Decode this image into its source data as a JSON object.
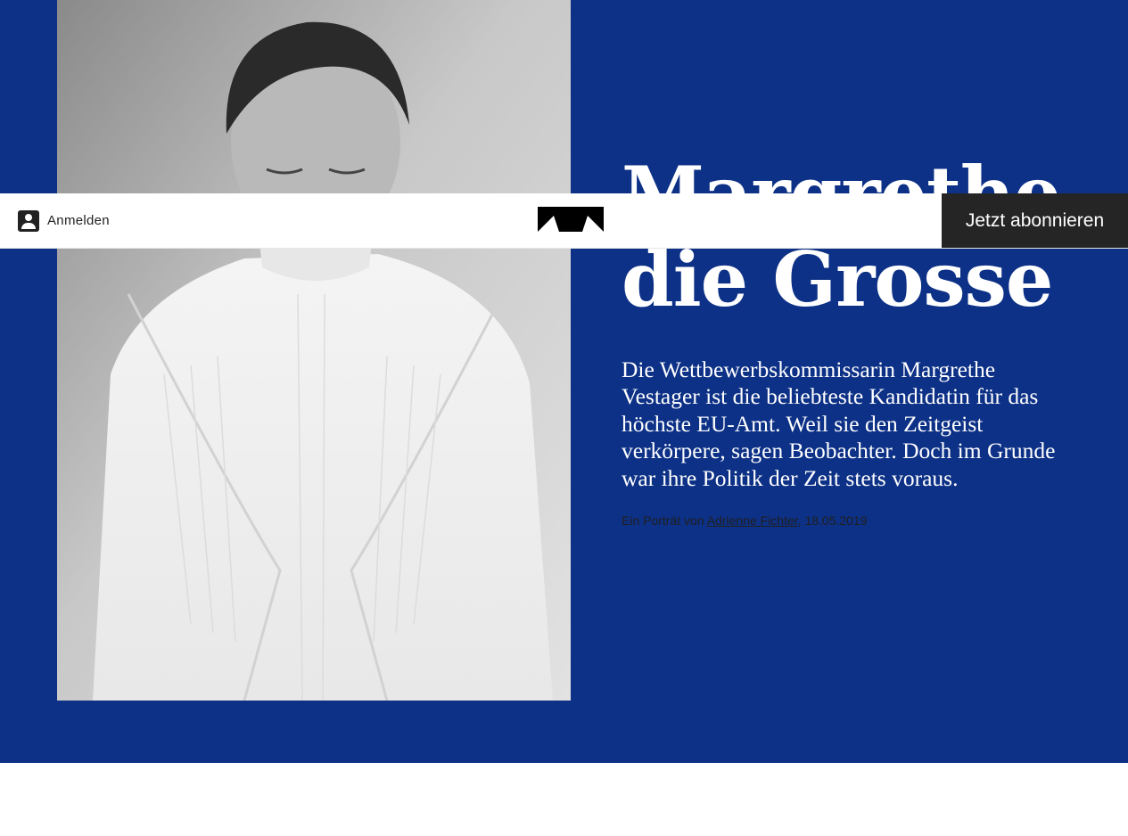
{
  "article": {
    "title": "Margrethe die Grosse",
    "lead": "Die Wettbewerbskommissarin Margrethe Vestager ist die beliebteste Kandidatin für das höchste EU-Amt. Weil sie den Zeitgeist verkörpere, sagen Beobachter. Doch im Grunde war ihre Politik der Zeit stets voraus.",
    "credit_prefix": "Ein Porträt von ",
    "author": "Adrienne Fichter",
    "date_sep": ", ",
    "date": "18.05.2019"
  },
  "nav": {
    "login_label": "Anmelden",
    "login_icon": "user-icon",
    "logo_icon": "republik-logo-icon",
    "subscribe_label": "Jetzt abonnieren"
  },
  "colors": {
    "hero_bg": "#0d3186",
    "subscribe_bg": "#252525",
    "text_light": "#ffffff",
    "text_dark": "#1f1f1f"
  }
}
